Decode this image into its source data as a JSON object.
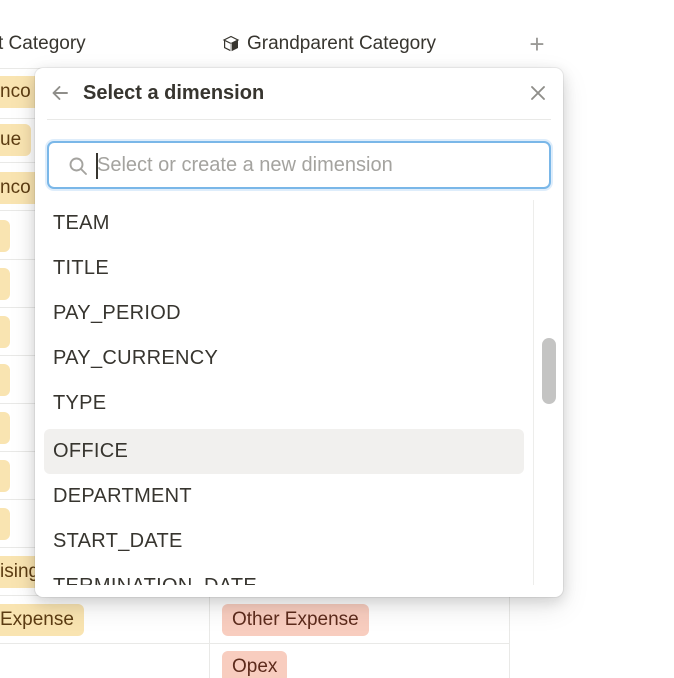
{
  "table": {
    "columns": [
      {
        "label": "t Category"
      },
      {
        "label": "Grandparent Category",
        "icon": "cube-icon"
      }
    ],
    "add_column_label": "+",
    "left_tags": [
      "nco",
      "ue",
      "nco",
      "ising",
      "Expense"
    ],
    "grandparent_tags": [
      "Other Expense",
      "Opex"
    ],
    "colors": {
      "yellow_tag": "#f9e4b1",
      "red_tag": "#f8cdbf"
    }
  },
  "popup": {
    "title": "Select a dimension",
    "back_icon": "arrow-left-icon",
    "close_icon": "close-icon",
    "search": {
      "placeholder": "Select or create a new dimension",
      "value": "",
      "icon": "search-icon",
      "focus_color": "#7ab7e8"
    },
    "items": [
      {
        "label": "TEAM"
      },
      {
        "label": "TITLE"
      },
      {
        "label": "PAY_PERIOD"
      },
      {
        "label": "PAY_CURRENCY"
      },
      {
        "label": "TYPE"
      },
      {
        "label": "OFFICE",
        "selected": true
      },
      {
        "label": "DEPARTMENT"
      },
      {
        "label": "START_DATE"
      },
      {
        "label": "TERMINATION_DATE"
      }
    ]
  }
}
